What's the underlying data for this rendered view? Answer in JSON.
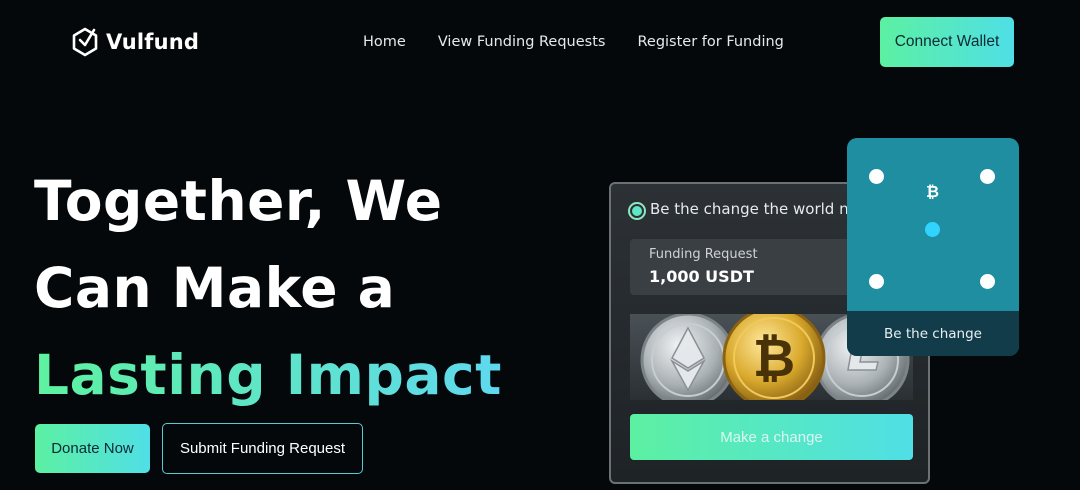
{
  "nav": {
    "brand": "Vulfund",
    "links": [
      "Home",
      "View Funding Requests",
      "Register for Funding"
    ],
    "connect_label": "Connect Wallet"
  },
  "hero": {
    "line1": "Together, We",
    "line2": "Can Make a",
    "line3": "Lasting Impact",
    "donate_label": "Donate Now",
    "submit_label": "Submit Funding Request"
  },
  "card": {
    "tagline": "Be the change the world n",
    "request_label": "Funding Request",
    "request_value": "1,000 USDT",
    "action_label": "Make a change"
  },
  "side_card": {
    "symbol": "₿",
    "footer": "Be the change"
  },
  "colors": {
    "accent_start": "#5cf0a2",
    "accent_end": "#50dfe6",
    "background": "#05080b",
    "side_card": "#1f8ea0"
  }
}
